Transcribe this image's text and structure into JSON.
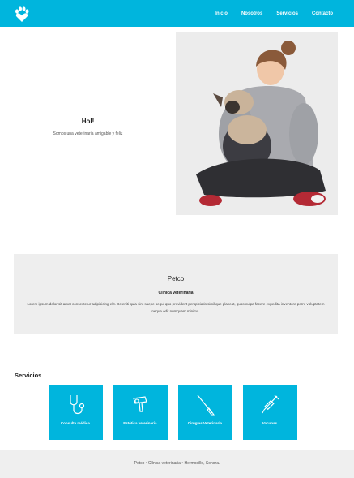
{
  "nav": {
    "logo_icon": "paw-heart-icon",
    "links": [
      {
        "label": "Inicio"
      },
      {
        "label": "Nosotros"
      },
      {
        "label": "Servicios"
      },
      {
        "label": "Contacto"
      }
    ],
    "color": "#00b5dd"
  },
  "hero": {
    "title": "Hol!",
    "subtitle": "Somos una veterinaria amigable y feliz"
  },
  "about": {
    "title": "Petco",
    "subtitle": "Clinica veterinaria",
    "body": "Lorem ipsum dolor sit amet consectetur adipisicing elit. Deleniti quia sint saepe sequi quo provident perspiciatis similique placeat, quas culpa facere expedita inventore porro voluptatem neque odit numquam minima."
  },
  "services": {
    "title": "Servicios",
    "items": [
      {
        "label": "Consulta médica.",
        "icon": "stethoscope-icon"
      },
      {
        "label": "Estética veterinaria.",
        "icon": "hair-dryer-icon"
      },
      {
        "label": "Cirugías Veterinaria.",
        "icon": "scalpel-icon"
      },
      {
        "label": "Vacunas.",
        "icon": "syringe-icon"
      }
    ]
  },
  "footer": {
    "text": "Petco • Clínica veterinaria • Hermosillo, Sonora."
  }
}
